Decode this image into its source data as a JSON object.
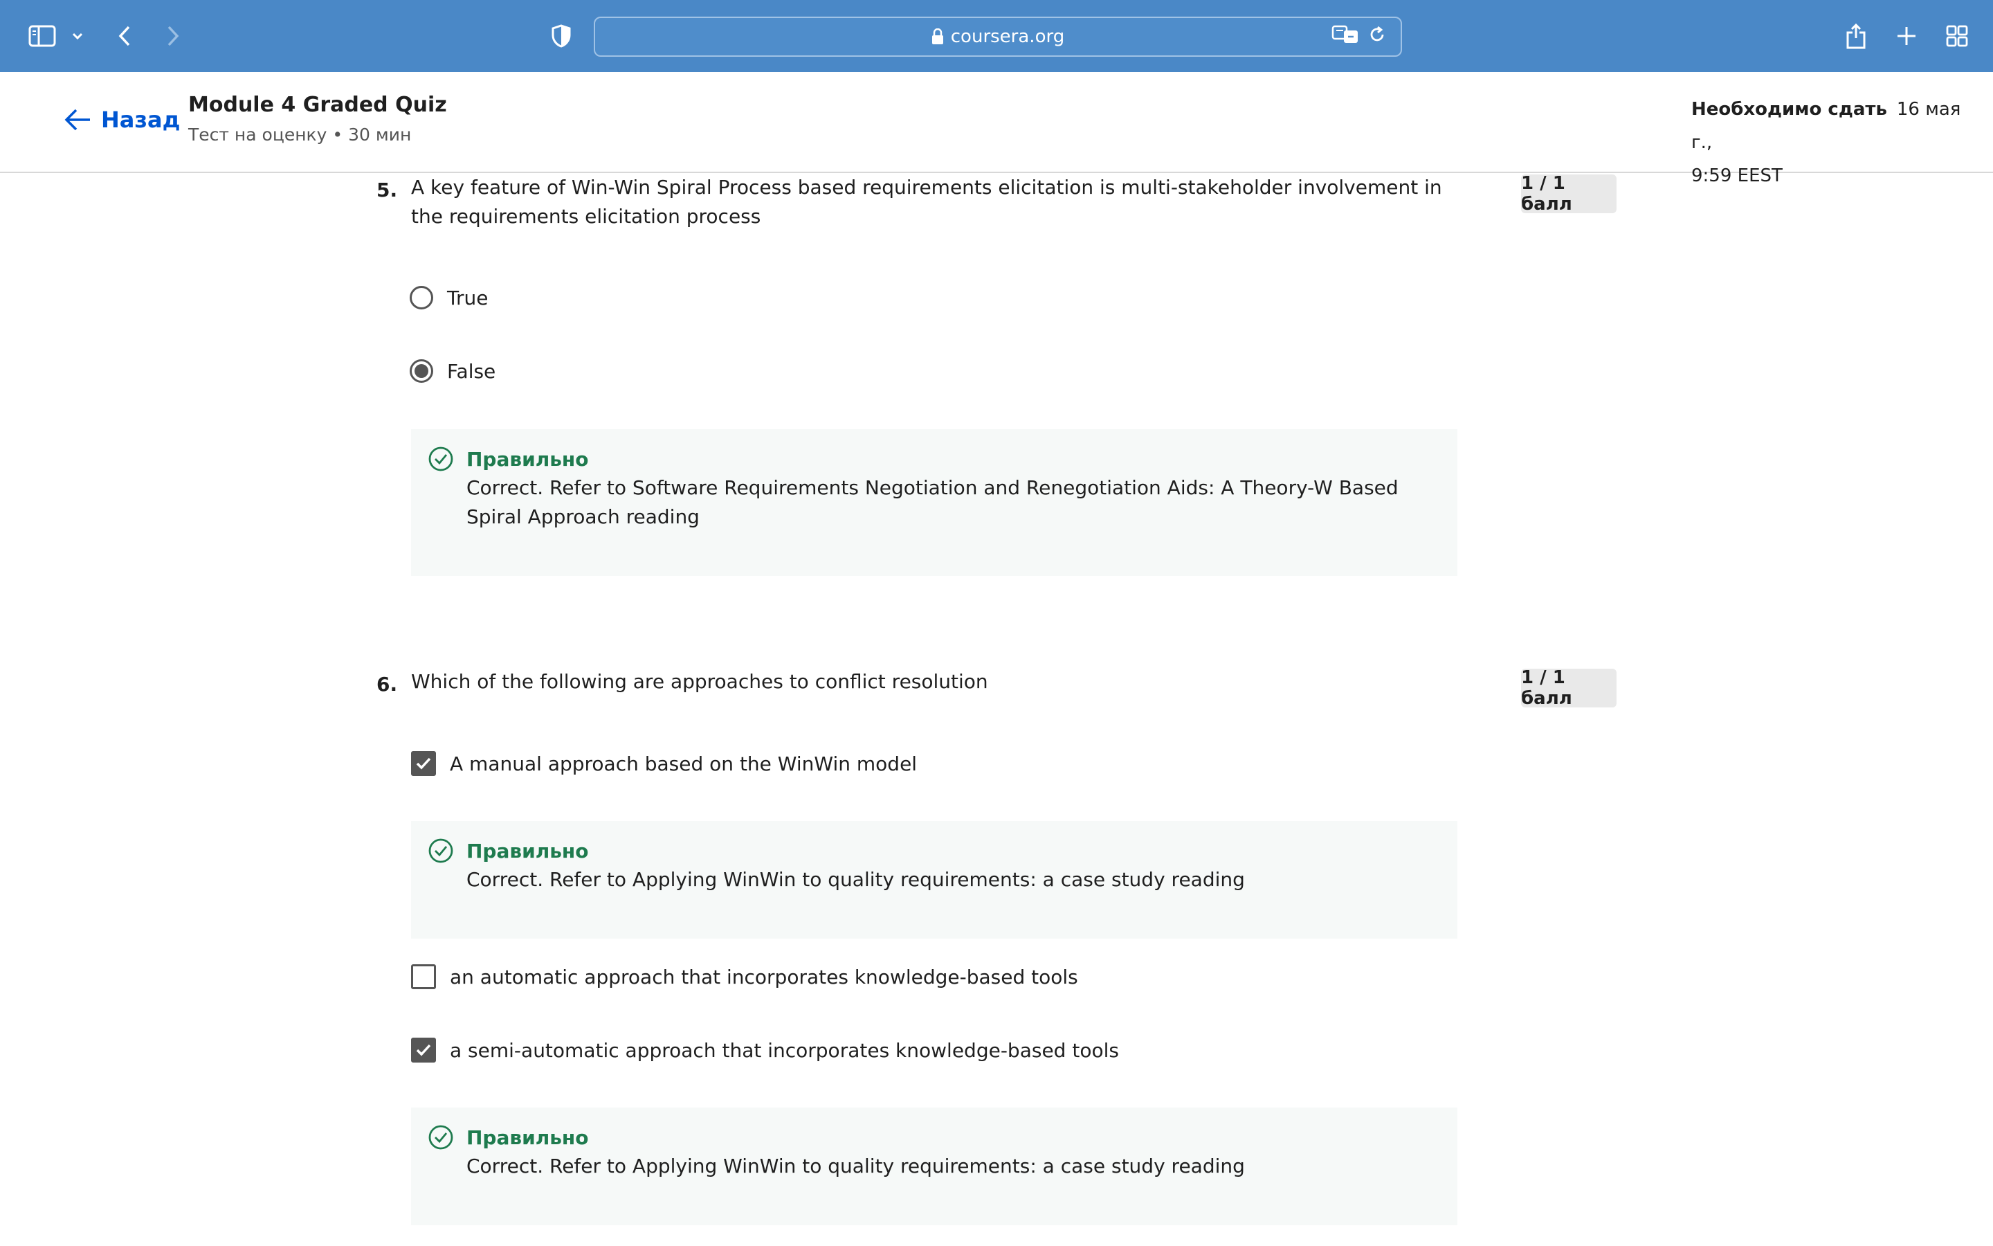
{
  "browser": {
    "url": "coursera.org",
    "colors": {
      "toolbar": "#4a88c7"
    }
  },
  "header": {
    "back_label": "Назад",
    "title": "Module 4 Graded Quiz",
    "subtitle": "Тест на оценку • 30 мин",
    "due_label": "Необходимо сдать",
    "due_date": "16 мая г.,",
    "due_time": "9:59 EEST"
  },
  "questions": [
    {
      "number": "5.",
      "text": "A key  feature  of  Win-Win  Spiral  Process  based  requirements elicitation is multi-stakeholder involvement in the requirements elicitation process",
      "points": "1 / 1 балл",
      "options": [
        {
          "label": "True",
          "selected": false
        },
        {
          "label": "False",
          "selected": true
        }
      ],
      "feedback": {
        "title": "Правильно",
        "text": "Correct. Refer to Software Requirements Negotiation and Renegotiation Aids: A Theory-W Based Spiral Approach reading"
      }
    },
    {
      "number": "6.",
      "text": "Which of the following are approaches to conflict resolution",
      "points": "1 / 1 балл",
      "options": [
        {
          "label": "A manual approach based on the WinWin model",
          "checked": true
        },
        {
          "label": "an automatic approach that incorporates knowledge-based tools",
          "checked": false
        },
        {
          "label": "a semi-automatic approach that incorporates knowledge-based tools",
          "checked": true
        }
      ],
      "feedback": [
        {
          "title": "Правильно",
          "text": "Correct. Refer to Applying WinWin to quality requirements: a case study reading"
        },
        {
          "title": "Правильно",
          "text": "Correct. Refer to Applying WinWin to quality requirements: a case study reading"
        }
      ]
    }
  ],
  "colors": {
    "link": "#0056d2",
    "correct": "#1e7b4e",
    "feedback_bg": "#f6f9f8"
  }
}
